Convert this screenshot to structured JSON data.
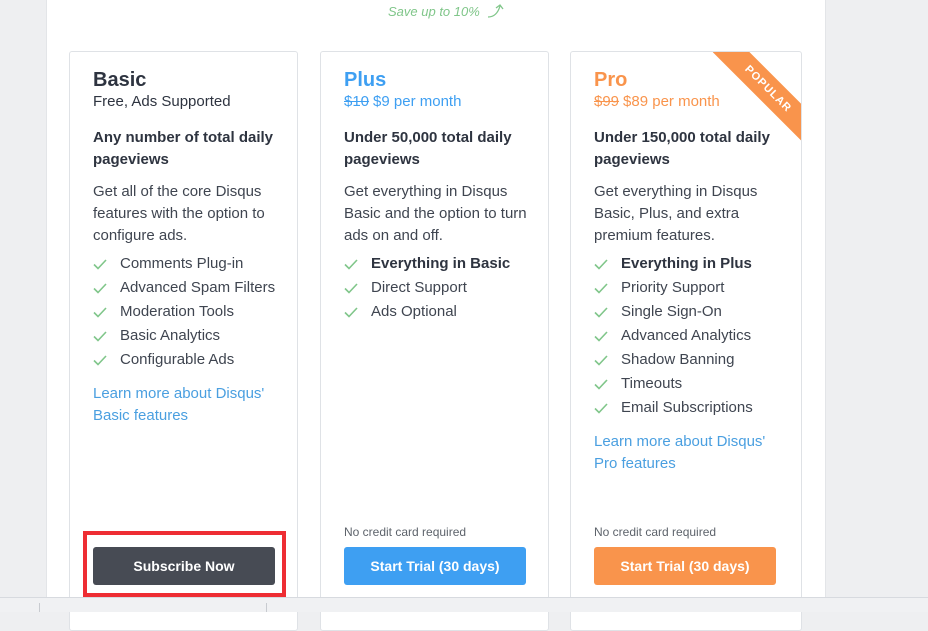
{
  "save_note": "Save up to 10%",
  "plans": {
    "basic": {
      "name": "Basic",
      "price": "Free, Ads Supported",
      "pageviews": "Any number of total daily pageviews",
      "description": "Get all of the core Disqus features with the option to configure ads.",
      "features": [
        "Comments Plug-in",
        "Advanced Spam Filters",
        "Moderation Tools",
        "Basic Analytics",
        "Configurable Ads"
      ],
      "learn_more": "Learn more about Disqus' Basic features",
      "cta": "Subscribe Now"
    },
    "plus": {
      "name": "Plus",
      "old_price": "$10",
      "price": "$9 per month",
      "pageviews": "Under 50,000 total daily pageviews",
      "description": "Get everything in Disqus Basic and the option to turn ads on and off.",
      "features": [
        "Everything in Basic",
        "Direct Support",
        "Ads Optional"
      ],
      "no_credit_card": "No credit card required",
      "cta": "Start Trial (30 days)"
    },
    "pro": {
      "name": "Pro",
      "badge": "POPULAR",
      "old_price": "$99",
      "price": "$89 per month",
      "pageviews": "Under 150,000 total daily pageviews",
      "description": "Get everything in Disqus Basic, Plus, and extra premium features.",
      "features": [
        "Everything in Plus",
        "Priority Support",
        "Single Sign-On",
        "Advanced Analytics",
        "Shadow Banning",
        "Timeouts",
        "Email Subscriptions"
      ],
      "learn_more": "Learn more about Disqus' Pro features",
      "no_credit_card": "No credit card required",
      "cta": "Start Trial (30 days)"
    }
  },
  "colors": {
    "plus_accent": "#3e9ff2",
    "pro_accent": "#f9944c",
    "basic_button": "#474b54",
    "check": "#80c68a",
    "link": "#4a9fe0",
    "highlight": "#ee2d33"
  }
}
